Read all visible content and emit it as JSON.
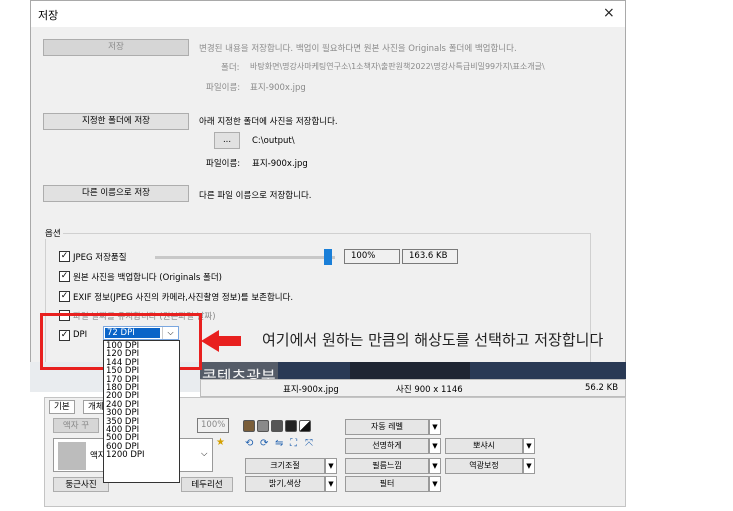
{
  "dialog": {
    "title": "저장",
    "close_icon": "×",
    "save": {
      "button": "저장",
      "desc": "변경된 내용을 저장합니다. 백업이 필요하다면 원본 사진을 Originals 폴더에 백업합니다.",
      "folder_label": "폴더:",
      "folder_path": "바탕화면\\명강사마케팅연구소\\1소책자\\출판원책2022\\명강사특급비밀99가지\\표소개글\\",
      "filename_label": "파일이름:",
      "filename": "표지-900x.jpg"
    },
    "save_to_folder": {
      "button": "지정한 폴더에 저장",
      "desc": "아래 지정한 폴더에 사진을 저장합니다.",
      "browse": "...",
      "path": "C:\\output\\",
      "filename_label": "파일이름:",
      "filename": "표지-900x.jpg"
    },
    "save_as": {
      "button": "다른 이름으로 저장",
      "desc": "다른 파일 이름으로 저장합니다."
    },
    "options": {
      "group_label": "옵션",
      "jpeg_quality": "JPEG 저장품질",
      "quality_value": "100%",
      "file_size": "163.6 KB",
      "quality_level": 1.0,
      "backup": "원본 사진을 백업합니다 (Originals 폴더)",
      "exif": "EXIF 정보(JPEG 사진의 카메라,사진촬영 정보)를 보존합니다.",
      "hidden_option": "파일 날짜를 유지합니다 (원본파일 날짜)",
      "dpi_label": "DPI",
      "dpi_selected": "72 DPI",
      "dpi_options": [
        "100 DPI",
        "120 DPI",
        "144 DPI",
        "150 DPI",
        "170 DPI",
        "180 DPI",
        "200 DPI",
        "240 DPI",
        "300 DPI",
        "350 DPI",
        "400 DPI",
        "500 DPI",
        "600 DPI",
        "1200 DPI"
      ]
    }
  },
  "annotation": "여기에서 원하는 만큼의 해상도를 선택하고 저장합니다",
  "watermark": "콘텐츠광부",
  "statusbar": {
    "filename": "표지-900x.jpg",
    "size": "사진 900 x 1146",
    "filesize": "56.2 KB"
  },
  "panel": {
    "tabs": [
      "기본",
      "개체"
    ],
    "frame_btn": "액자 꾸",
    "zoom": "100%",
    "side_label": "액자",
    "round_btn": "둥근사진",
    "border_btn": "테두리선",
    "buttons": {
      "auto_level": "자동 레벨",
      "sharpen": "선명하게",
      "blur": "뽀샤시",
      "resize": "크기조절",
      "film": "필름느낌",
      "backlight": "역광보정",
      "bright": "밝기,색상",
      "filter": "필터"
    },
    "colors": {
      "accent": "#1a7fd8",
      "annotation_red": "#e8201f",
      "selection_blue": "#0a64c8"
    }
  }
}
